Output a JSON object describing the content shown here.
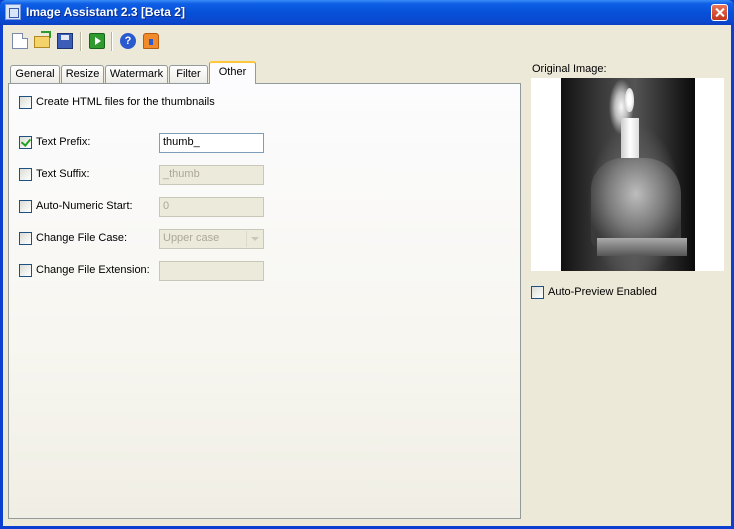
{
  "window": {
    "title": "Image Assistant 2.3 [Beta 2]"
  },
  "toolbar": {
    "icons": [
      "new-file-icon",
      "open-folder-icon",
      "save-icon",
      "run-icon",
      "help-icon",
      "home-icon"
    ]
  },
  "tabs": [
    {
      "label": "General"
    },
    {
      "label": "Resize"
    },
    {
      "label": "Watermark"
    },
    {
      "label": "Filter"
    },
    {
      "label": "Other",
      "active": true
    }
  ],
  "other": {
    "create_html": {
      "label": "Create HTML files for the thumbnails",
      "checked": false
    },
    "text_prefix": {
      "label": "Text Prefix:",
      "checked": true,
      "value": "thumb_"
    },
    "text_suffix": {
      "label": "Text Suffix:",
      "checked": false,
      "value": "_thumb"
    },
    "auto_numeric": {
      "label": "Auto-Numeric Start:",
      "checked": false,
      "value": "0"
    },
    "file_case": {
      "label": "Change File Case:",
      "checked": false,
      "value": "Upper case"
    },
    "file_ext": {
      "label": "Change File Extension:",
      "checked": false,
      "value": ""
    }
  },
  "preview": {
    "label": "Original Image:",
    "auto_preview": {
      "label": "Auto-Preview Enabled",
      "checked": false
    }
  }
}
